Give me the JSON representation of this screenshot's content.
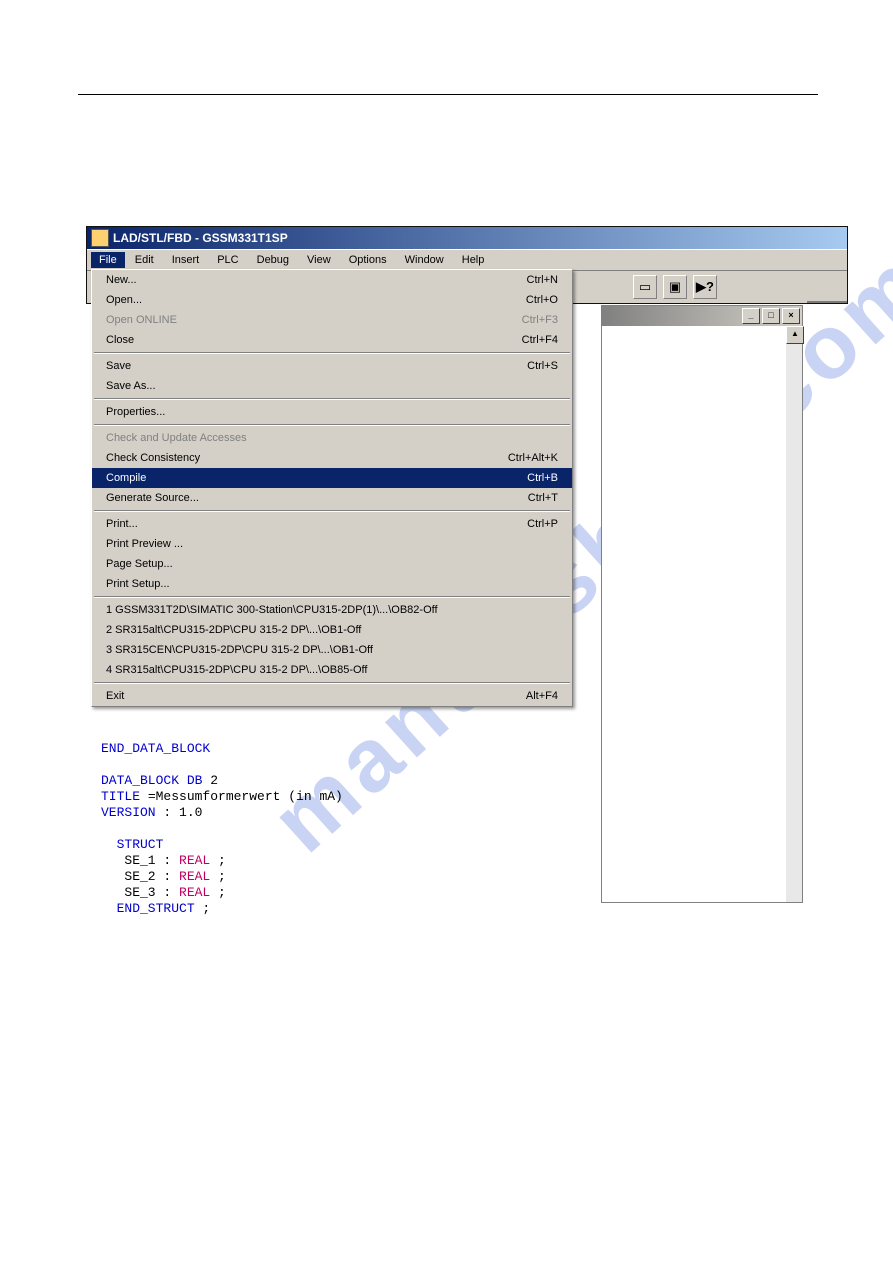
{
  "title": "LAD/STL/FBD  - GSSM331T1SP",
  "watermark": "manualshive.com",
  "menubar": [
    "File",
    "Edit",
    "Insert",
    "PLC",
    "Debug",
    "View",
    "Options",
    "Window",
    "Help"
  ],
  "file_menu": {
    "groups": [
      [
        {
          "label": "New...",
          "shortcut": "Ctrl+N",
          "disabled": false
        },
        {
          "label": "Open...",
          "shortcut": "Ctrl+O",
          "disabled": false
        },
        {
          "label": "Open ONLINE",
          "shortcut": "Ctrl+F3",
          "disabled": true
        },
        {
          "label": "Close",
          "shortcut": "Ctrl+F4",
          "disabled": false
        }
      ],
      [
        {
          "label": "Save",
          "shortcut": "Ctrl+S",
          "disabled": false
        },
        {
          "label": "Save As...",
          "shortcut": "",
          "disabled": false
        }
      ],
      [
        {
          "label": "Properties...",
          "shortcut": "",
          "disabled": false
        }
      ],
      [
        {
          "label": "Check and Update Accesses",
          "shortcut": "",
          "disabled": true
        },
        {
          "label": "Check Consistency",
          "shortcut": "Ctrl+Alt+K",
          "disabled": false
        },
        {
          "label": "Compile",
          "shortcut": "Ctrl+B",
          "disabled": false,
          "selected": true
        },
        {
          "label": "Generate Source...",
          "shortcut": "Ctrl+T",
          "disabled": false
        }
      ],
      [
        {
          "label": "Print...",
          "shortcut": "Ctrl+P",
          "disabled": false
        },
        {
          "label": "Print Preview ...",
          "shortcut": "",
          "disabled": false
        },
        {
          "label": "Page Setup...",
          "shortcut": "",
          "disabled": false
        },
        {
          "label": "Print Setup...",
          "shortcut": "",
          "disabled": false
        }
      ],
      [
        {
          "label": "1 GSSM331T2D\\SIMATIC 300-Station\\CPU315-2DP(1)\\...\\OB82-Off",
          "shortcut": "",
          "disabled": false
        },
        {
          "label": "2 SR315alt\\CPU315-2DP\\CPU 315-2 DP\\...\\OB1-Off",
          "shortcut": "",
          "disabled": false
        },
        {
          "label": "3 SR315CEN\\CPU315-2DP\\CPU 315-2 DP\\...\\OB1-Off",
          "shortcut": "",
          "disabled": false
        },
        {
          "label": "4 SR315alt\\CPU315-2DP\\CPU 315-2 DP\\...\\OB85-Off",
          "shortcut": "",
          "disabled": false
        }
      ],
      [
        {
          "label": "Exit",
          "shortcut": "Alt+F4",
          "disabled": false
        }
      ]
    ]
  },
  "code_lines": [
    {
      "t": "END_DATA_BLOCK",
      "cls": "kw-blue"
    },
    {
      "t": "",
      "cls": ""
    },
    {
      "t": "DATA_BLOCK DB",
      "tail": " 2",
      "cls": "kw-blue"
    },
    {
      "t": "TITLE",
      "tail": " =Messumformerwert (in mA)",
      "cls": "kw-blue"
    },
    {
      "t": "VERSION",
      "tail": " : 1.0",
      "cls": "kw-blue"
    },
    {
      "t": "",
      "cls": ""
    },
    {
      "t": "  STRUCT",
      "cls": "kw-blue"
    },
    {
      "t": "   SE_1 : ",
      "kw": "REAL",
      "tail": " ;",
      "cls": ""
    },
    {
      "t": "   SE_2 : ",
      "kw": "REAL",
      "tail": " ;",
      "cls": ""
    },
    {
      "t": "   SE_3 : ",
      "kw": "REAL",
      "tail": " ;",
      "cls": ""
    },
    {
      "t": "  END_STRUCT",
      "tail": " ;",
      "cls": "kw-blue"
    }
  ],
  "win_buttons": {
    "min": "_",
    "max": "□",
    "close": "×"
  },
  "scroll": {
    "up": "▲"
  }
}
